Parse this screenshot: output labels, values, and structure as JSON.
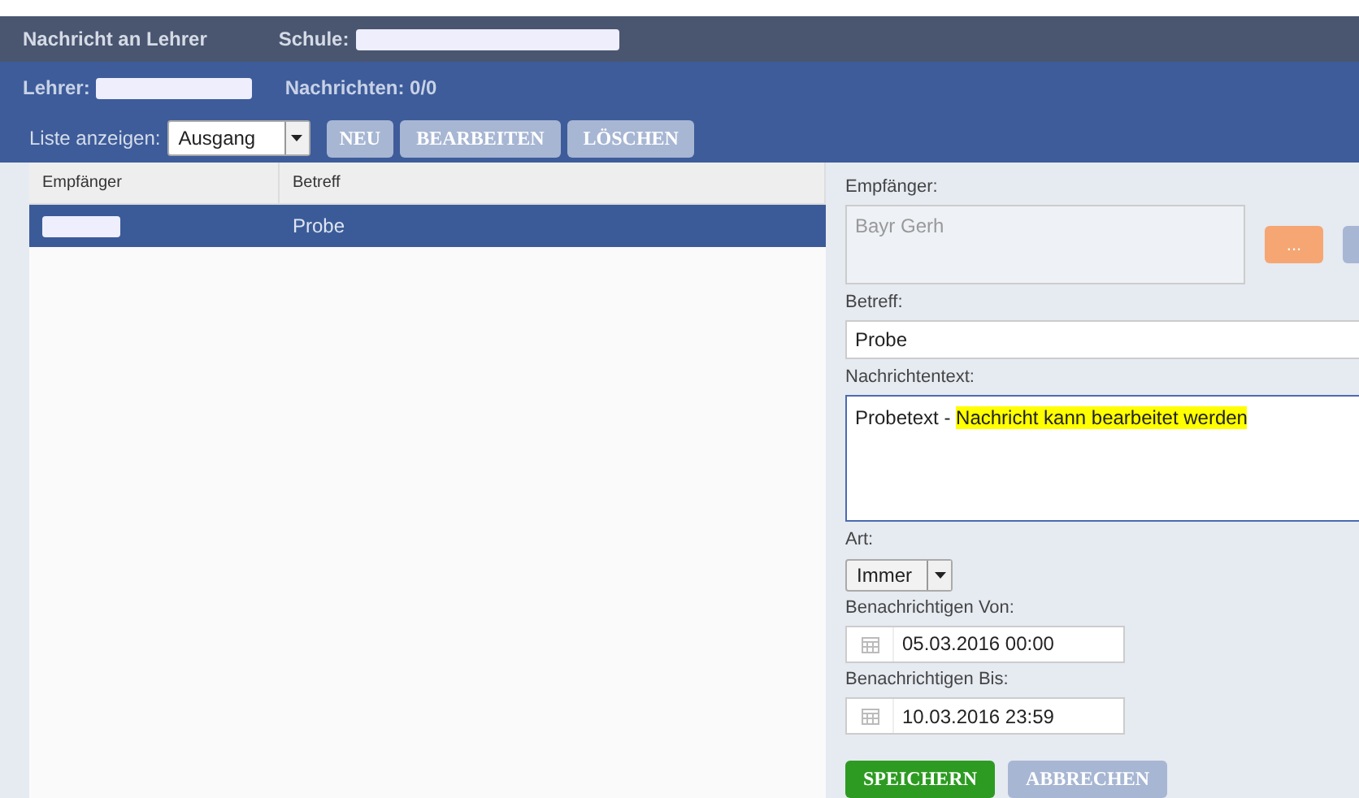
{
  "header": {
    "title": "Nachricht an Lehrer",
    "school_label": "Schule:"
  },
  "info_bar": {
    "teacher_label": "Lehrer:",
    "messages": "Nachrichten: 0/0"
  },
  "toolbar": {
    "list_label": "Liste anzeigen:",
    "list_value": "Ausgang",
    "buttons": [
      {
        "label": "NEU",
        "disabled": true
      },
      {
        "label": "BEARBEITEN",
        "disabled": true
      },
      {
        "label": "LÖSCHEN",
        "disabled": true
      }
    ]
  },
  "table": {
    "columns": [
      "Empfänger",
      "Betreff"
    ],
    "rows": [
      {
        "subject": "Probe",
        "selected": true
      }
    ]
  },
  "form": {
    "recipient_label": "Empfänger:",
    "recipient_value": "Bayr Gerh",
    "recipient_button": "...",
    "subject_label": "Betreff:",
    "subject_value": "Probe",
    "message_label": "Nachrichtentext:",
    "message_segments": [
      {
        "text": "Probetext - ",
        "highlighted": false
      },
      {
        "text": "Nachricht kann bearbeitet werden",
        "highlighted": true
      }
    ],
    "art_label": "Art:",
    "art_value": "Immer",
    "from_label": "Benachrichtigen Von:",
    "from_value": "05.03.2016 00:00",
    "to_label": "Benachrichtigen Bis:",
    "to_value": "10.03.2016 23:59",
    "buttons": [
      {
        "label": "SPEICHERN",
        "disabled": false
      },
      {
        "label": "ABBRECHEN",
        "disabled": true
      }
    ]
  }
}
